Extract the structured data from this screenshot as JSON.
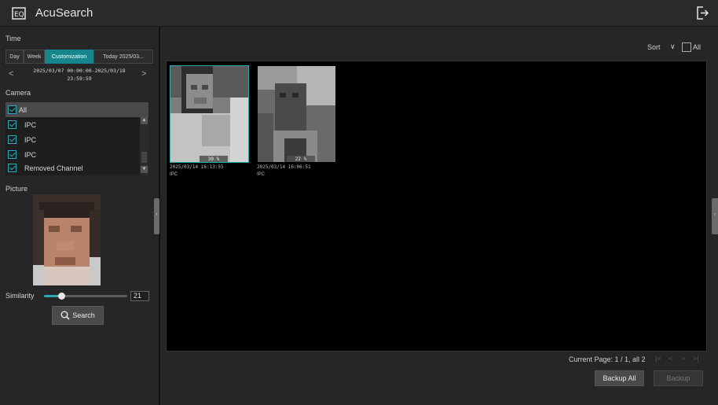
{
  "app": {
    "title": "AcuSearch",
    "icon": "face-search-icon",
    "exit_icon": "exit-icon"
  },
  "left": {
    "time_label": "Time",
    "tabs": [
      {
        "label": "Day",
        "active": false
      },
      {
        "label": "Week",
        "active": false
      },
      {
        "label": "Customization",
        "active": true
      },
      {
        "label": "Today 2025/03...",
        "active": false
      }
    ],
    "range": {
      "line1": "2025/03/07 00:00:00-2025/03/18",
      "line2": "23:59:59",
      "prev": "<",
      "next": ">"
    },
    "camera_label": "Camera",
    "cameras": [
      {
        "label": "All",
        "checked": true
      },
      {
        "label": "IPC",
        "checked": true
      },
      {
        "label": "IPC",
        "checked": true
      },
      {
        "label": "IPC",
        "checked": true
      },
      {
        "label": "Removed Channel",
        "checked": true
      }
    ],
    "picture_label": "Picture",
    "similarity": {
      "label": "Similarity",
      "value": "21",
      "fraction": 0.21
    },
    "search_button": "Search"
  },
  "main": {
    "sort": {
      "label": "Sort",
      "all_label": "All"
    },
    "results": [
      {
        "similarity": "30 %",
        "time": "2025/03/14 16:13:55",
        "camera": "IPC",
        "selected": true
      },
      {
        "similarity": "22 %",
        "time": "2025/03/14 16:06:51",
        "camera": "IPC",
        "selected": false
      }
    ],
    "pager": {
      "text": "Current Page: 1 / 1, all 2"
    },
    "buttons": {
      "backup_all": "Backup All",
      "backup": "Backup"
    }
  }
}
